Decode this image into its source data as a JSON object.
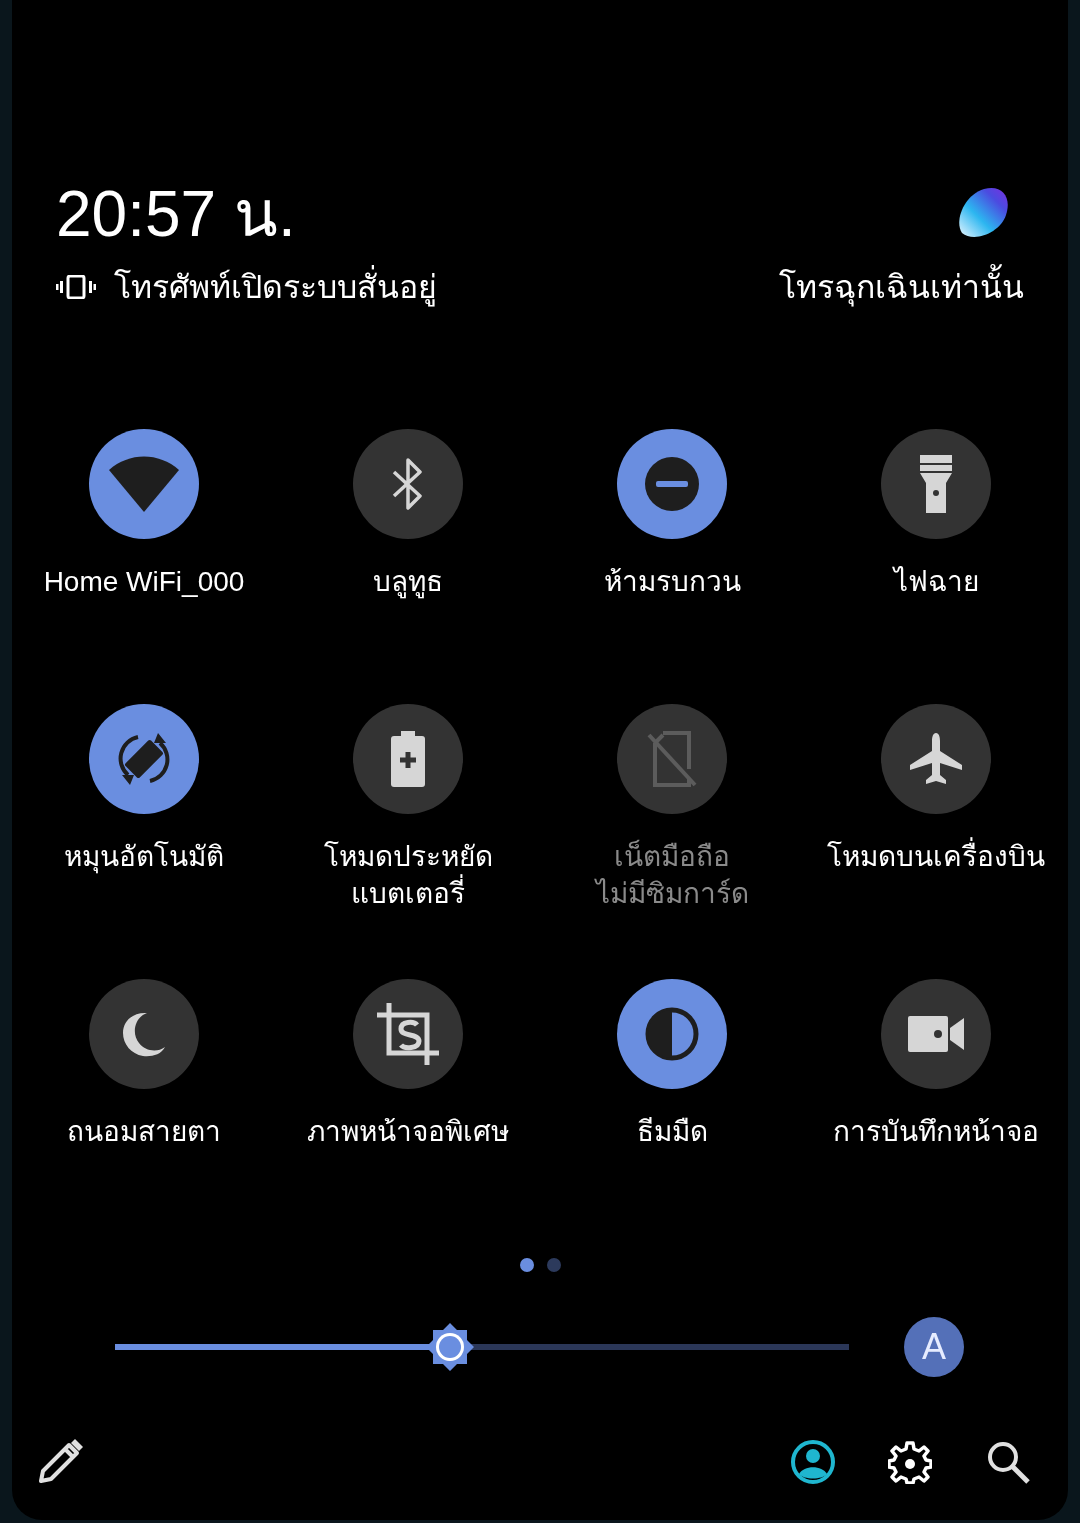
{
  "header": {
    "time": "20:57 น.",
    "ringer_status": "โทรศัพท์เปิดระบบสั่นอยู่",
    "carrier_status": "โทรฉุกเฉินเท่านั้น"
  },
  "tiles": [
    {
      "kind": "wifi",
      "label": "Home WiFi_000",
      "on": true,
      "disabled": false
    },
    {
      "kind": "bluetooth",
      "label": "บลูทูธ",
      "on": false,
      "disabled": false
    },
    {
      "kind": "dnd",
      "label": "ห้ามรบกวน",
      "on": true,
      "disabled": false
    },
    {
      "kind": "flashlight",
      "label": "ไฟฉาย",
      "on": false,
      "disabled": false
    },
    {
      "kind": "rotate",
      "label": "หมุนอัตโนมัติ",
      "on": true,
      "disabled": false
    },
    {
      "kind": "battery",
      "label": "โหมดประหยัด\nแบตเตอรี่",
      "on": false,
      "disabled": false
    },
    {
      "kind": "nosim",
      "label": "เน็ตมือถือ\nไม่มีซิมการ์ด",
      "on": false,
      "disabled": true
    },
    {
      "kind": "airplane",
      "label": "โหมดบนเครื่องบิน",
      "on": false,
      "disabled": false
    },
    {
      "kind": "moon",
      "label": "ถนอมสายตา",
      "on": false,
      "disabled": false
    },
    {
      "kind": "screenshot",
      "label": "ภาพหน้าจอพิเศษ",
      "on": false,
      "disabled": false
    },
    {
      "kind": "contrast",
      "label": "ธีมมืด",
      "on": true,
      "disabled": false
    },
    {
      "kind": "video",
      "label": "การบันทึกหน้าจอ",
      "on": false,
      "disabled": false
    }
  ],
  "pages": [
    {
      "selected": true
    },
    {
      "selected": false
    }
  ],
  "brightness": {
    "level": 0.456,
    "auto_label": "A"
  }
}
